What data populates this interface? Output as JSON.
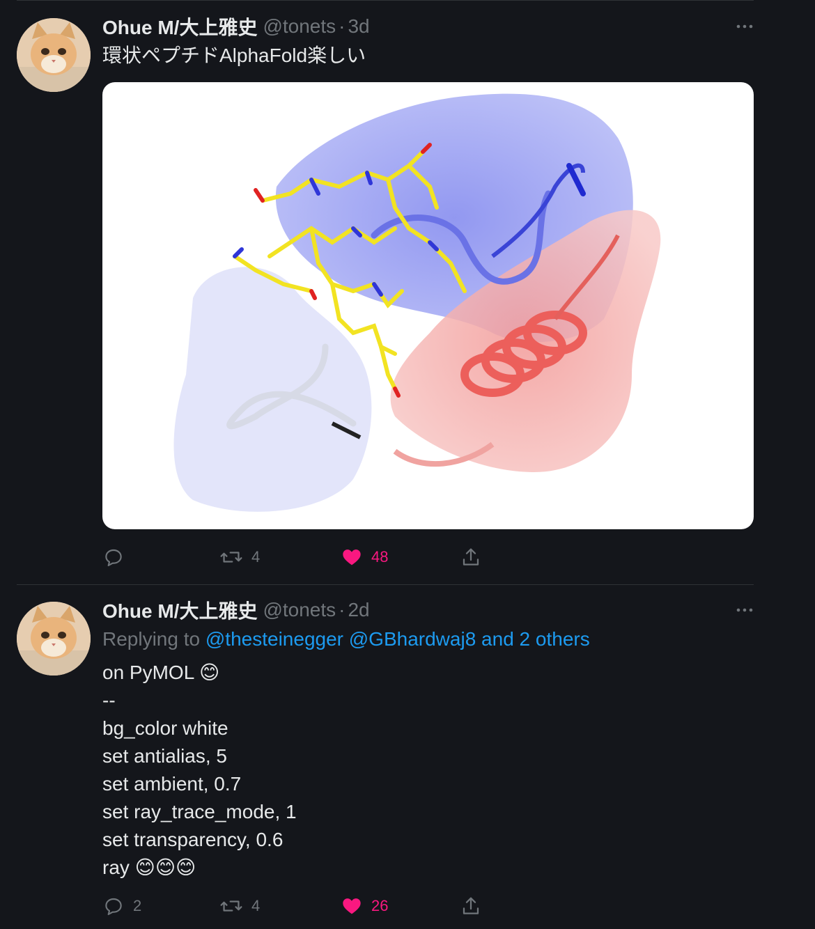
{
  "tweets": [
    {
      "author_name": "Ohue M/大上雅史",
      "handle": "@tonets",
      "separator": "·",
      "time": "3d",
      "text": "環状ペプチドAlphaFold楽しい",
      "has_media": true,
      "actions": {
        "reply_count": "",
        "retweet_count": "4",
        "like_count": "48",
        "liked": true
      }
    },
    {
      "author_name": "Ohue M/大上雅史",
      "handle": "@tonets",
      "separator": "·",
      "time": "2d",
      "replying_prefix": "Replying to",
      "replying_to": "@thesteinegger @GBhardwaj8 and 2 others",
      "lines": [
        "on PyMOL 😊",
        "--",
        "bg_color white",
        "set antialias, 5",
        "set ambient, 0.7",
        "set ray_trace_mode, 1",
        "set transparency, 0.6",
        "ray 😊😊😊"
      ],
      "actions": {
        "reply_count": "2",
        "retweet_count": "4",
        "like_count": "26",
        "liked": true
      }
    }
  ],
  "icons": {
    "reply": "reply-icon",
    "retweet": "retweet-icon",
    "like": "heart-icon",
    "share": "share-icon",
    "more": "more-icon"
  },
  "colors": {
    "background": "#14161b",
    "text": "#e7e9ea",
    "muted": "#71767b",
    "link": "#1d9bf0",
    "like": "#f91880"
  }
}
